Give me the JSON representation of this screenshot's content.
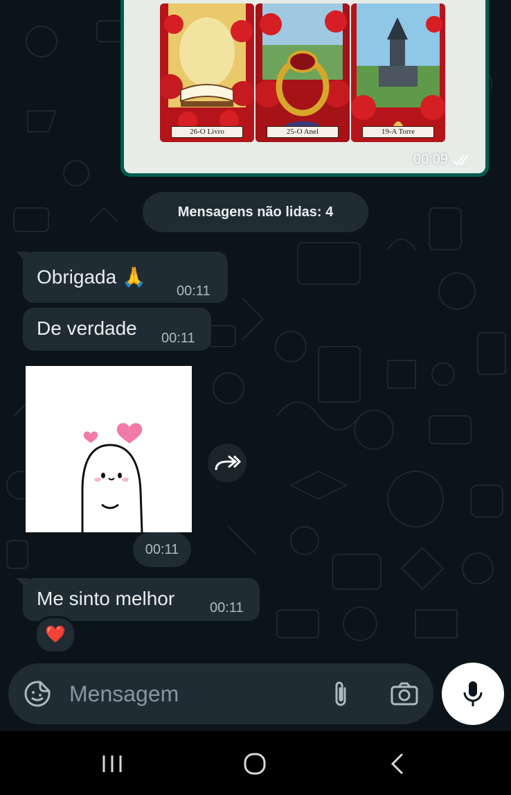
{
  "chat": {
    "image_message": {
      "cards": [
        {
          "label": "26-O Livro"
        },
        {
          "label": "25-O Anel"
        },
        {
          "label": "19-A Torre"
        }
      ],
      "time": "00:09",
      "status_icon": "double-check-icon"
    },
    "unread_banner": "Mensagens não lidas: 4",
    "messages": [
      {
        "text": "Obrigada 🙏",
        "time": "00:11"
      },
      {
        "text": "De verdade",
        "time": "00:11"
      },
      {
        "sticker": "smiling-blob-with-hearts",
        "time": "00:11"
      },
      {
        "text": "Me sinto melhor",
        "time": "00:11",
        "reaction": "❤️"
      }
    ]
  },
  "composer": {
    "placeholder": "Mensagem",
    "icons": [
      "sticker-icon",
      "attach-icon",
      "camera-icon",
      "mic-icon"
    ]
  },
  "navbar": {
    "icons": [
      "recent-apps-icon",
      "home-icon",
      "back-icon"
    ]
  },
  "colors": {
    "background": "#0b141a",
    "incoming_bubble": "#202c33",
    "outgoing_bubble": "#005c4b",
    "secondary_text": "#aebac1",
    "primary_text": "#e9edef"
  }
}
